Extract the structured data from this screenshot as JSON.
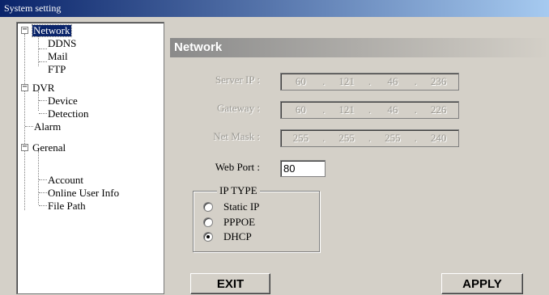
{
  "window": {
    "title": "System setting"
  },
  "tree": {
    "network": "Network",
    "ddns": "DDNS",
    "mail": "Mail",
    "ftp": "FTP",
    "dvr": "DVR",
    "device": "Device",
    "detection": "Detection",
    "alarm": "Alarm",
    "general": "Gerenal",
    "account": "Account",
    "online_user_info": "Online User Info",
    "file_path": "File Path",
    "expander_symbol": "−"
  },
  "panel": {
    "heading": "Network",
    "server_ip": {
      "label": "Server IP :",
      "octets": [
        "60",
        "121",
        "46",
        "236"
      ]
    },
    "gateway": {
      "label": "Gateway :",
      "octets": [
        "60",
        "121",
        "46",
        "226"
      ]
    },
    "net_mask": {
      "label": "Net Mask :",
      "octets": [
        "255",
        "255",
        "255",
        "240"
      ]
    },
    "ip_dot": ".",
    "web_port": {
      "label": "Web Port :",
      "value": "80"
    },
    "ip_type": {
      "title": "IP TYPE",
      "options": [
        "Static IP",
        "PPPOE",
        "DHCP"
      ],
      "selected": "DHCP"
    },
    "exit_label": "EXIT",
    "apply_label": "APPLY"
  }
}
